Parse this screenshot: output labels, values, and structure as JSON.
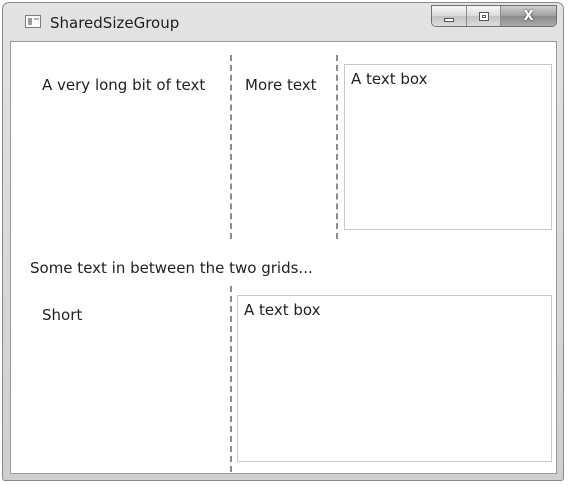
{
  "window": {
    "title": "SharedSizeGroup",
    "close_glyph": "X",
    "icons": [
      "app-icon",
      "minimize-icon",
      "maximize-icon",
      "close-icon"
    ]
  },
  "grid1": {
    "col1_text": "A very long bit of text",
    "col2_text": "More text",
    "textbox_value": "A text box"
  },
  "between_text": "Some text in between the two grids...",
  "grid2": {
    "col1_text": "Short",
    "textbox_value": "A text box"
  }
}
